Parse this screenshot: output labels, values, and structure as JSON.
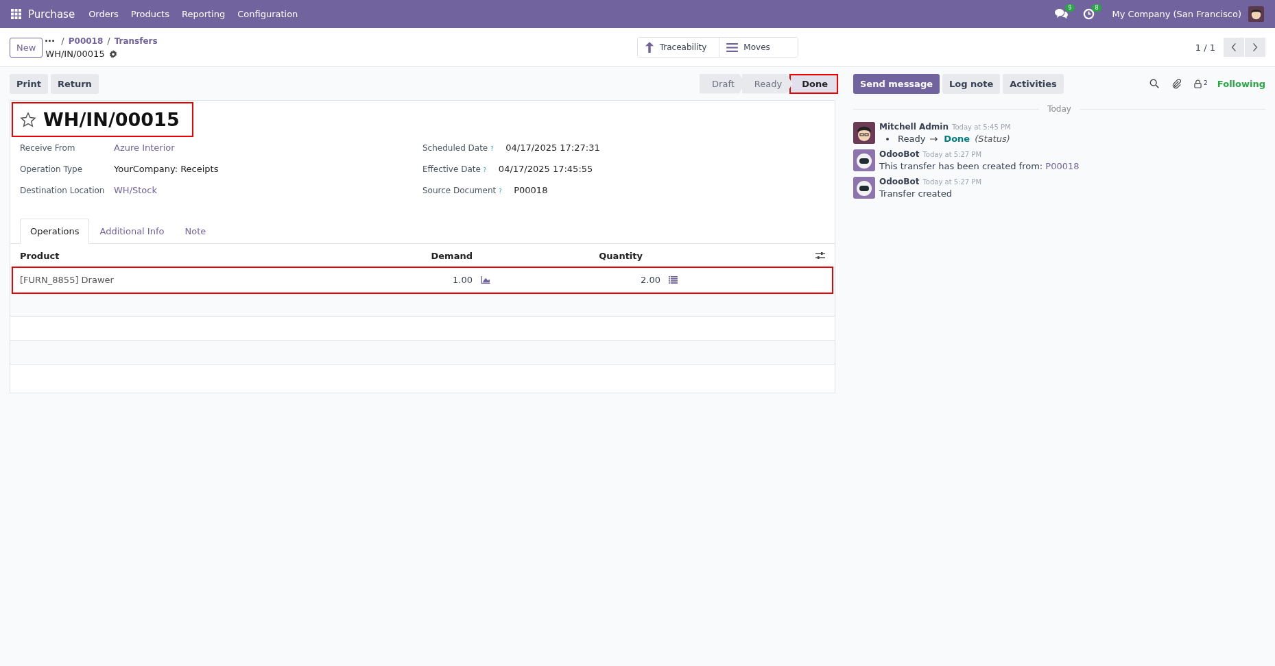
{
  "navbar": {
    "app": "Purchase",
    "menu": [
      "Orders",
      "Products",
      "Reporting",
      "Configuration"
    ],
    "messages_badge": "9",
    "activities_badge": "8",
    "company": "My Company (San Francisco)"
  },
  "control_panel": {
    "new_button": "New",
    "breadcrumbs": [
      {
        "separator": "/",
        "label": "P00018"
      },
      {
        "separator": "/",
        "label": "Transfers"
      }
    ],
    "record": "WH/IN/00015",
    "smart_buttons": [
      {
        "kind": "traceability",
        "label": "Traceability"
      },
      {
        "kind": "moves",
        "label": "Moves"
      }
    ],
    "pager": "1 / 1"
  },
  "actions": [
    "Print",
    "Return"
  ],
  "statusbar": [
    {
      "label": "Draft",
      "selected": false,
      "highlighted": false
    },
    {
      "label": "Ready",
      "selected": false,
      "highlighted": false
    },
    {
      "label": "Done",
      "selected": true,
      "highlighted": true
    }
  ],
  "form": {
    "title": "WH/IN/00015",
    "title_highlighted": true,
    "starred": false,
    "left_fields": [
      {
        "label": "Receive From",
        "value": "Azure Interior",
        "link": true
      },
      {
        "label": "Operation Type",
        "value": "YourCompany: Receipts",
        "link": false
      },
      {
        "label": "Destination Location",
        "value": "WH/Stock",
        "link": true
      }
    ],
    "right_fields": [
      {
        "label": "Scheduled Date",
        "help": "?",
        "value": "04/17/2025 17:27:31"
      },
      {
        "label": "Effective Date",
        "help": "?",
        "value": "04/17/2025 17:45:55"
      },
      {
        "label": "Source Document",
        "help": "?",
        "value": "P00018"
      }
    ],
    "tabs": [
      {
        "label": "Operations",
        "selected": true
      },
      {
        "label": "Additional Info",
        "selected": false
      },
      {
        "label": "Note",
        "selected": false
      }
    ],
    "table": {
      "columns": [
        "Product",
        "Demand",
        "Quantity"
      ],
      "rows": [
        {
          "product": "[FURN_8855] Drawer",
          "demand": "1.00",
          "quantity": "2.00",
          "highlighted": true
        }
      ]
    }
  },
  "chatter": {
    "buttons": [
      {
        "label": "Send message",
        "selected": true
      },
      {
        "label": "Log note",
        "selected": false
      },
      {
        "label": "Activities",
        "selected": false
      }
    ],
    "followers_count": "2",
    "following": "Following",
    "date_separator": "Today",
    "messages": [
      {
        "author": "Mitchell Admin",
        "avatar": {
          "kind": "person"
        },
        "time": "Today at 5:45 PM",
        "kind": "tracking",
        "old": "Ready",
        "new": "Done",
        "field": "(Status)"
      },
      {
        "author": "OdooBot",
        "avatar": {
          "kind": "bot"
        },
        "time": "Today at 5:27 PM",
        "kind": "link",
        "text": "This transfer has been created from:",
        "link": "P00018"
      },
      {
        "author": "OdooBot",
        "avatar": {
          "kind": "bot"
        },
        "time": "Today at 5:27 PM",
        "kind": "text",
        "text": "Transfer created"
      }
    ]
  }
}
